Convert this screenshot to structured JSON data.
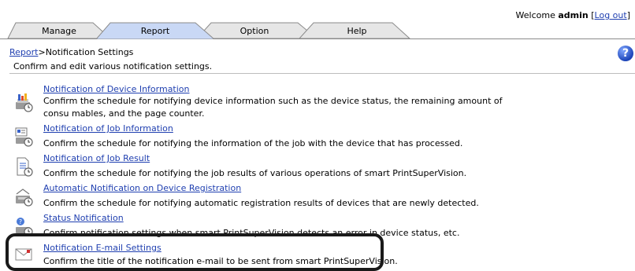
{
  "header": {
    "welcome_prefix": "Welcome",
    "user": "admin",
    "logout_label": "Log out"
  },
  "tabs": [
    {
      "label": "Manage",
      "active": false
    },
    {
      "label": "Report",
      "active": true
    },
    {
      "label": "Option",
      "active": false
    },
    {
      "label": "Help",
      "active": false
    }
  ],
  "breadcrumb": {
    "parent": "Report",
    "separator": ">",
    "current": "Notification Settings"
  },
  "subtitle": "Confirm and edit various notification settings.",
  "help_icon": "?",
  "items": [
    {
      "icon": "device-information-icon",
      "title": "Notification of Device Information",
      "description": "Confirm the schedule for notifying device information such as the device status, the remaining amount of consu mables, and the page counter."
    },
    {
      "icon": "job-information-icon",
      "title": "Notification of Job Information",
      "description": "Confirm the schedule for notifying the information of the job with the device that has processed."
    },
    {
      "icon": "job-result-icon",
      "title": "Notification of Job Result",
      "description": "Confirm the schedule for notifying the job results of various operations of smart PrintSuperVision."
    },
    {
      "icon": "device-registration-icon",
      "title": "Automatic Notification on Device Registration",
      "description": "Confirm the schedule for notifying automatic registration results of devices that are newly detected."
    },
    {
      "icon": "status-notification-icon",
      "title": "Status Notification",
      "description": "Confirm notification settings when smart PrintSuperVision detects an error in device status, etc."
    },
    {
      "icon": "email-settings-icon",
      "title": "Notification E-mail Settings",
      "description": "Confirm the title of the notification e-mail to be sent from smart PrintSuperVision."
    }
  ],
  "colors": {
    "link": "#1f3fb0",
    "active_tab": "#c9d8f5",
    "highlight_border": "#1a1a1a"
  }
}
